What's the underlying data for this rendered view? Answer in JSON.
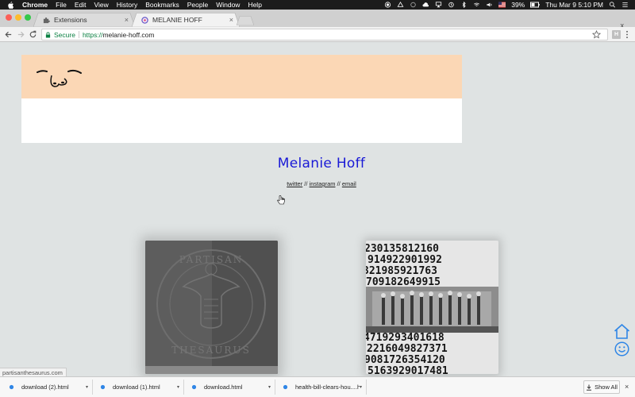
{
  "menubar": {
    "app_name": "Chrome",
    "items": [
      "File",
      "Edit",
      "View",
      "History",
      "Bookmarks",
      "People",
      "Window",
      "Help"
    ],
    "battery": "39%",
    "datetime": "Thu Mar 9  5:10 PM"
  },
  "tabs": [
    {
      "label": "Extensions",
      "close": "×",
      "icon": "puzzle-icon"
    },
    {
      "label": "MELANIE HOFF",
      "close": "×",
      "icon": "site-favicon"
    }
  ],
  "window": {
    "close_profile": "x"
  },
  "address_bar": {
    "secure_label": "Secure",
    "url_scheme": "https://",
    "url_host": "melanie-hoff.com"
  },
  "toolbar": {
    "extension_label": "H"
  },
  "page": {
    "title": "Melanie Hoff",
    "links": {
      "twitter": "twitter",
      "sep1": " // ",
      "instagram": "instagram",
      "sep2": " // ",
      "email": "email"
    },
    "thumbnails": [
      {
        "name": "partisan-thesaurus",
        "text_top": "PARTISAN",
        "text_bottom": "THESAURUS"
      },
      {
        "name": "health-bill-collage"
      }
    ]
  },
  "status_bar": {
    "url": "partisanthesaurus.com"
  },
  "downloads": {
    "items": [
      {
        "name": "download (2).html"
      },
      {
        "name": "download (1).html"
      },
      {
        "name": "download.html"
      },
      {
        "name": "health-bill-clears-hou....html"
      }
    ],
    "show_all": "Show All",
    "close": "×"
  },
  "colors": {
    "banner": "#fbd7b5",
    "title_link": "#1a1ad6",
    "secure_green": "#0b8043",
    "page_bg": "#dfe3e3",
    "icon_blue": "#2f86e6"
  }
}
